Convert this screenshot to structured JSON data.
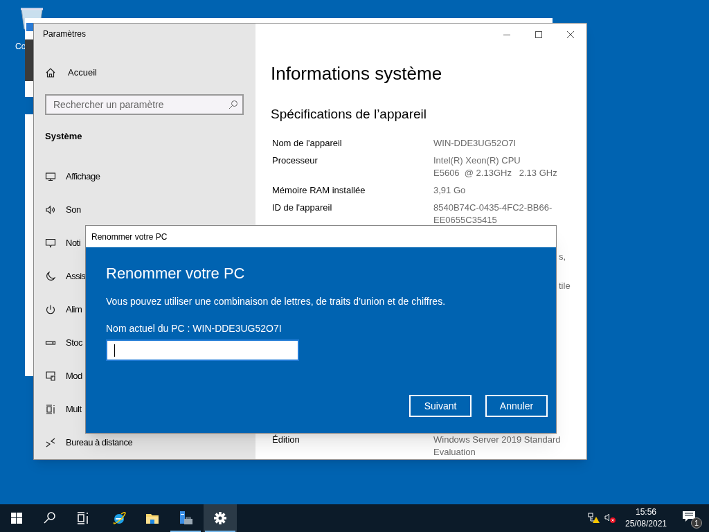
{
  "desktop": {
    "icon_label": "Co"
  },
  "settings_window": {
    "title": "Paramètres",
    "nav": {
      "home": "Accueil",
      "search_placeholder": "Rechercher un paramètre",
      "section": "Système",
      "items": [
        {
          "kind": "display",
          "label": "Affichage"
        },
        {
          "kind": "sound",
          "label": "Son"
        },
        {
          "kind": "notifications",
          "label": "Noti"
        },
        {
          "kind": "focus",
          "label": "Assis"
        },
        {
          "kind": "power",
          "label": "Alim"
        },
        {
          "kind": "storage",
          "label": "Stoc"
        },
        {
          "kind": "tablet",
          "label": "Mod"
        },
        {
          "kind": "multitask",
          "label": "Mult"
        },
        {
          "kind": "remote",
          "label": "Bureau à distance"
        }
      ]
    },
    "content": {
      "title": "Informations système",
      "subtitle": "Spécifications de l’appareil",
      "specs": [
        {
          "label": "Nom de l'appareil",
          "value": "WIN-DDE3UG52O7I"
        },
        {
          "label": "Processeur",
          "value": "Intel(R) Xeon(R) CPU\nE5606  @ 2.13GHz   2.13 GHz"
        },
        {
          "label": "Mémoire RAM installée",
          "value": "3,91 Go"
        },
        {
          "label": "ID de l'appareil",
          "value": "8540B74C-0435-4FC2-BB66-\nEE0655C35415"
        }
      ],
      "obscured_fragments": [
        "s,",
        "tile"
      ],
      "edition": {
        "label": "Édition",
        "value": "Windows Server 2019 Standard\nEvaluation"
      }
    }
  },
  "dialog": {
    "title": "Renommer votre PC",
    "heading": "Renommer votre PC",
    "description": "Vous pouvez utiliser une combinaison de lettres, de traits d’union et de chiffres.",
    "current_name": "Nom actuel du PC : WIN-DDE3UG52O7I",
    "buttons": [
      "Suivant",
      "Annuler"
    ]
  },
  "taskbar": {
    "apps": [
      {
        "kind": "start",
        "running": false,
        "selected": false
      },
      {
        "kind": "search",
        "running": false,
        "selected": false
      },
      {
        "kind": "taskview",
        "running": false,
        "selected": false
      },
      {
        "kind": "browser",
        "running": false,
        "selected": false
      },
      {
        "kind": "folder",
        "running": false,
        "selected": false
      },
      {
        "kind": "server",
        "running": true,
        "selected": false
      },
      {
        "kind": "settings",
        "running": true,
        "selected": true
      }
    ],
    "time": "15:56",
    "date": "25/08/2021",
    "notification_count": "1"
  }
}
